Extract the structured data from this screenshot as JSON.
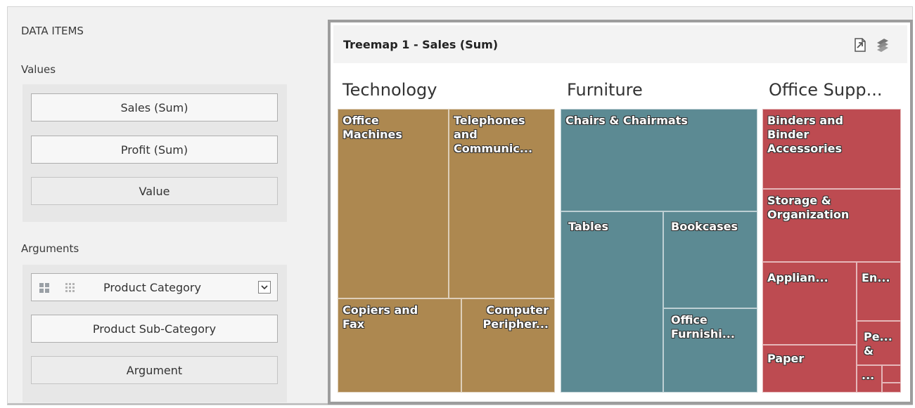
{
  "panel": {
    "title": "DATA ITEMS",
    "values": {
      "label": "Values",
      "items": [
        "Sales (Sum)",
        "Profit (Sum)"
      ],
      "placeholder": "Value"
    },
    "arguments": {
      "label": "Arguments",
      "items": [
        "Product Category",
        "Product Sub-Category"
      ],
      "placeholder": "Argument"
    }
  },
  "treemap": {
    "title": "Treemap 1 - Sales (Sum)",
    "export_icon": "export-icon",
    "layers_icon": "layers-icon",
    "colors": {
      "technology": "#ad8850",
      "furniture": "#5c8a93",
      "office_supplies": "#bd4b51"
    },
    "categories": {
      "technology": "Technology",
      "furniture": "Furniture",
      "office_supplies": "Office Supp..."
    },
    "tiles": {
      "office_machines": "Office\nMachines",
      "telephones": "Telephones\nand\nCommunic...",
      "copiers_fax": "Copiers and\nFax",
      "computer_peripherals": "Computer\nPeripher...",
      "chairs": "Chairs & Chairmats",
      "tables": "Tables",
      "bookcases": "Bookcases",
      "office_furnishings": "Office\nFurnishi...",
      "binders": "Binders and\nBinder\nAccessories",
      "storage": "Storage &\nOrganization",
      "appliances": "Applian...",
      "envelopes": "En...",
      "paper": "Paper",
      "pens": "Pe...\n&",
      "misc": "..."
    }
  }
}
